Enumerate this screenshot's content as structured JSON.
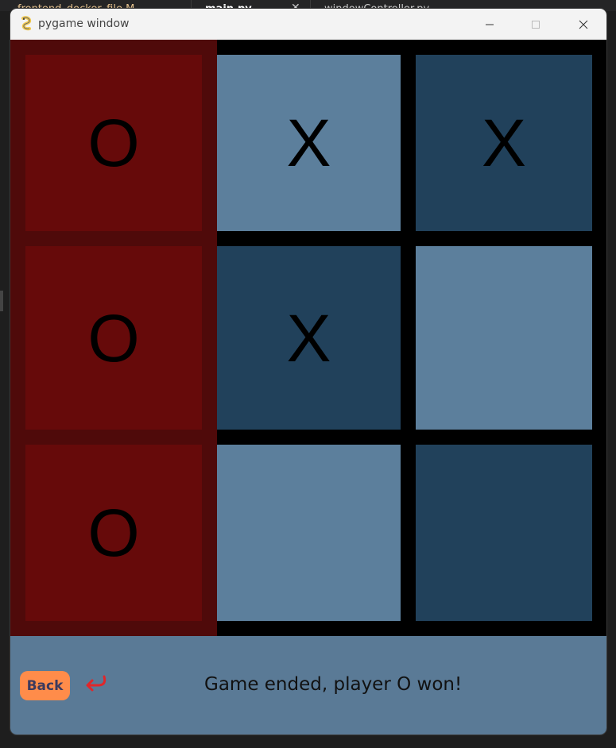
{
  "background_tabs": [
    {
      "label": "frontend_docker_file M"
    },
    {
      "label": "main.py"
    },
    {
      "label": "windowController.py"
    }
  ],
  "window": {
    "title": "pygame window",
    "controls": {
      "minimize": "minimize-icon",
      "maximize": "maximize-icon",
      "close": "close-icon"
    }
  },
  "board": {
    "rows": [
      [
        {
          "mark": "O",
          "color": "#660a0a"
        },
        {
          "mark": "X",
          "color": "#5c7f9c"
        },
        {
          "mark": "X",
          "color": "#21415b"
        }
      ],
      [
        {
          "mark": "O",
          "color": "#660a0a"
        },
        {
          "mark": "X",
          "color": "#21415b"
        },
        {
          "mark": "",
          "color": "#5c7f9c"
        }
      ],
      [
        {
          "mark": "O",
          "color": "#660a0a"
        },
        {
          "mark": "",
          "color": "#5c7f9c"
        },
        {
          "mark": "",
          "color": "#21415b"
        }
      ]
    ],
    "winning_column": 0
  },
  "status": {
    "back_label": "Back",
    "message": "Game ended, player O won!"
  },
  "colors": {
    "winning_strip": "#4f0a0a",
    "status_bar": "#5a7a96",
    "back_button": "#ff8c4a",
    "return_arrow": "#e0262a"
  }
}
